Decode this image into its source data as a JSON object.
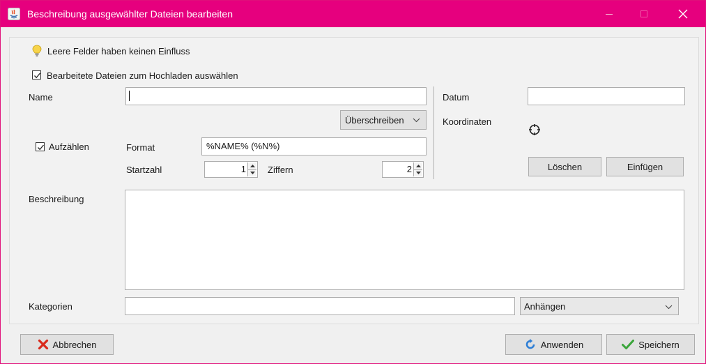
{
  "window": {
    "title": "Beschreibung ausgewählter Dateien bearbeiten",
    "accent": "#e6007e"
  },
  "hint": {
    "text": "Leere Felder haben keinen Einfluss",
    "icon": "lightbulb-icon"
  },
  "select_edited": {
    "label": "Bearbeitete Dateien zum Hochladen auswählen",
    "checked": true
  },
  "name": {
    "label": "Name",
    "value": ""
  },
  "overwrite": {
    "label": "Überschreiben"
  },
  "enumerate": {
    "label": "Aufzählen",
    "checked": true
  },
  "format": {
    "label": "Format",
    "value": "%NAME% (%N%)"
  },
  "start_number": {
    "label": "Startzahl",
    "value": "1"
  },
  "digits": {
    "label": "Ziffern",
    "value": "2"
  },
  "date": {
    "label": "Datum",
    "value": ""
  },
  "coordinates": {
    "label": "Koordinaten",
    "icon": "crosshair-icon"
  },
  "coord_buttons": {
    "delete": "Löschen",
    "insert": "Einfügen"
  },
  "description": {
    "label": "Beschreibung",
    "value": ""
  },
  "categories": {
    "label": "Kategorien",
    "value": "",
    "mode": "Anhängen"
  },
  "footer": {
    "cancel": "Abbrechen",
    "apply": "Anwenden",
    "save": "Speichern"
  }
}
